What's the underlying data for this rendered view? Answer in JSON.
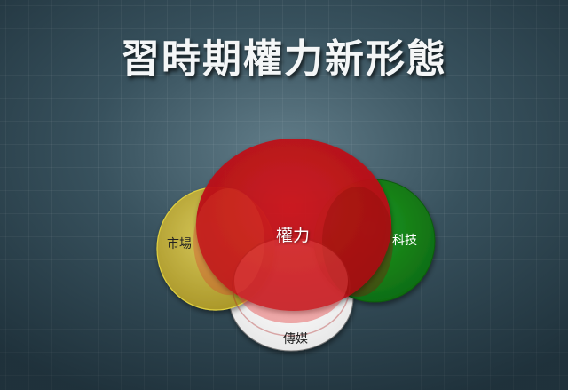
{
  "title": "習時期權力新形態",
  "diagram": {
    "center_label": "權力",
    "left_label": "市場",
    "right_label": "科技",
    "bottom_label": "傳媒",
    "colors": {
      "power": "#c8141a",
      "market": "#c9b43a",
      "technology": "#178a1a",
      "media": "#ffffff"
    }
  }
}
